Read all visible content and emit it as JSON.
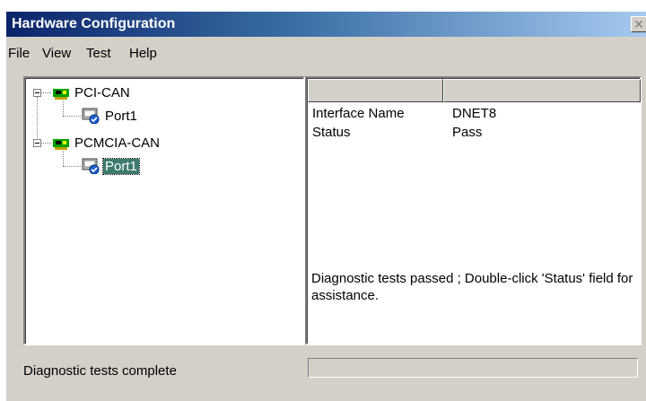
{
  "window": {
    "title": "Hardware Configuration",
    "close_glyph": "✕"
  },
  "menu": [
    "File",
    "View",
    "Test",
    "Help"
  ],
  "tree": {
    "nodes": [
      {
        "label": "PCI-CAN",
        "icon": "pci-card-icon",
        "children": [
          {
            "label": "Port1",
            "icon": "port-icon"
          }
        ]
      },
      {
        "label": "PCMCIA-CAN",
        "icon": "pcmcia-card-icon",
        "children": [
          {
            "label": "Port1",
            "icon": "port-icon",
            "selected": true
          }
        ]
      }
    ]
  },
  "details": {
    "columns": [
      "",
      ""
    ],
    "properties": [
      {
        "name": "Interface Name",
        "value": "DNET8"
      },
      {
        "name": "Status",
        "value": "Pass"
      }
    ],
    "message": "Diagnostic tests passed ; Double-click 'Status' field for assistance."
  },
  "status_bar": {
    "text": "Diagnostic tests complete",
    "progress": 0
  },
  "colors": {
    "titlebar_start": "#0a246a",
    "titlebar_end": "#a6caf0",
    "face": "#d4d0c8",
    "card_green": "#00a000",
    "selection": "#3c7a6f"
  }
}
